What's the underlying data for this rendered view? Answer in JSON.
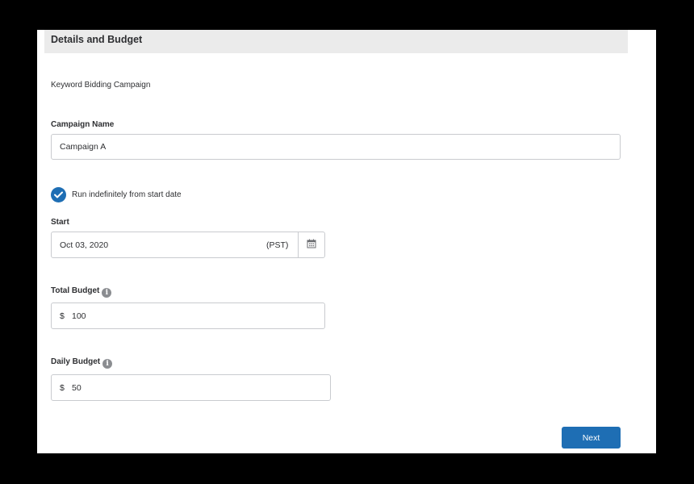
{
  "section": {
    "title": "Details and Budget"
  },
  "campaign_type": "Keyword Bidding Campaign",
  "campaign_name": {
    "label": "Campaign Name",
    "value": "Campaign A"
  },
  "run_indefinitely": {
    "label": "Run indefinitely from start date",
    "checked": true
  },
  "start": {
    "label": "Start",
    "value": "Oct 03, 2020",
    "timezone": "(PST)",
    "calendar_icon": "calendar-icon"
  },
  "total_budget": {
    "label": "Total Budget",
    "currency": "$",
    "value": "100",
    "info_icon": "info-icon"
  },
  "daily_budget": {
    "label": "Daily Budget",
    "currency": "$",
    "value": "50",
    "info_icon": "info-icon"
  },
  "actions": {
    "next_label": "Next"
  },
  "colors": {
    "accent": "#1e6eb4",
    "header_bg": "#ebebeb",
    "border": "#c9cbcf"
  }
}
